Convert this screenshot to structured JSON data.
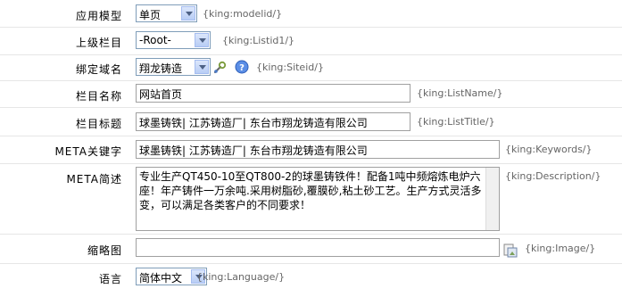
{
  "fields": {
    "model": {
      "label": "应用模型",
      "value": "单页",
      "hint": "{king:modelid/}"
    },
    "parent": {
      "label": "上级栏目",
      "value": "-Root-",
      "hint": "{king:Listid1/}"
    },
    "site": {
      "label": "绑定域名",
      "value": "翔龙铸造",
      "hint": "{king:Siteid/}"
    },
    "name": {
      "label": "栏目名称",
      "value": "网站首页",
      "hint": "{king:ListName/}"
    },
    "title": {
      "label": "栏目标题",
      "value": "球墨铸铁| 江苏铸造厂| 东台市翔龙铸造有限公司",
      "hint": "{king:ListTitle/}"
    },
    "keywords": {
      "label": "META关键字",
      "value": "球墨铸铁| 江苏铸造厂| 东台市翔龙铸造有限公司",
      "hint": "{king:Keywords/}"
    },
    "description": {
      "label": "META简述",
      "value": "专业生产QT450-10至QT800-2的球墨铸铁件！配备1吨中频熔炼电炉六座！年产铸件一万余吨.采用树脂砂,覆膜砂,粘土砂工艺。生产方式灵活多变，可以满足各类客户的不同要求！",
      "hint": "{king:Description/}"
    },
    "image": {
      "label": "缩略图",
      "value": "",
      "hint": "{king:Image/}"
    },
    "language": {
      "label": "语言",
      "value": "简体中文",
      "hint": "{king:Language/}"
    }
  },
  "icons": {
    "site_tool": "wrench-icon",
    "site_help": "help-icon",
    "image_browse": "image-browse-icon"
  }
}
